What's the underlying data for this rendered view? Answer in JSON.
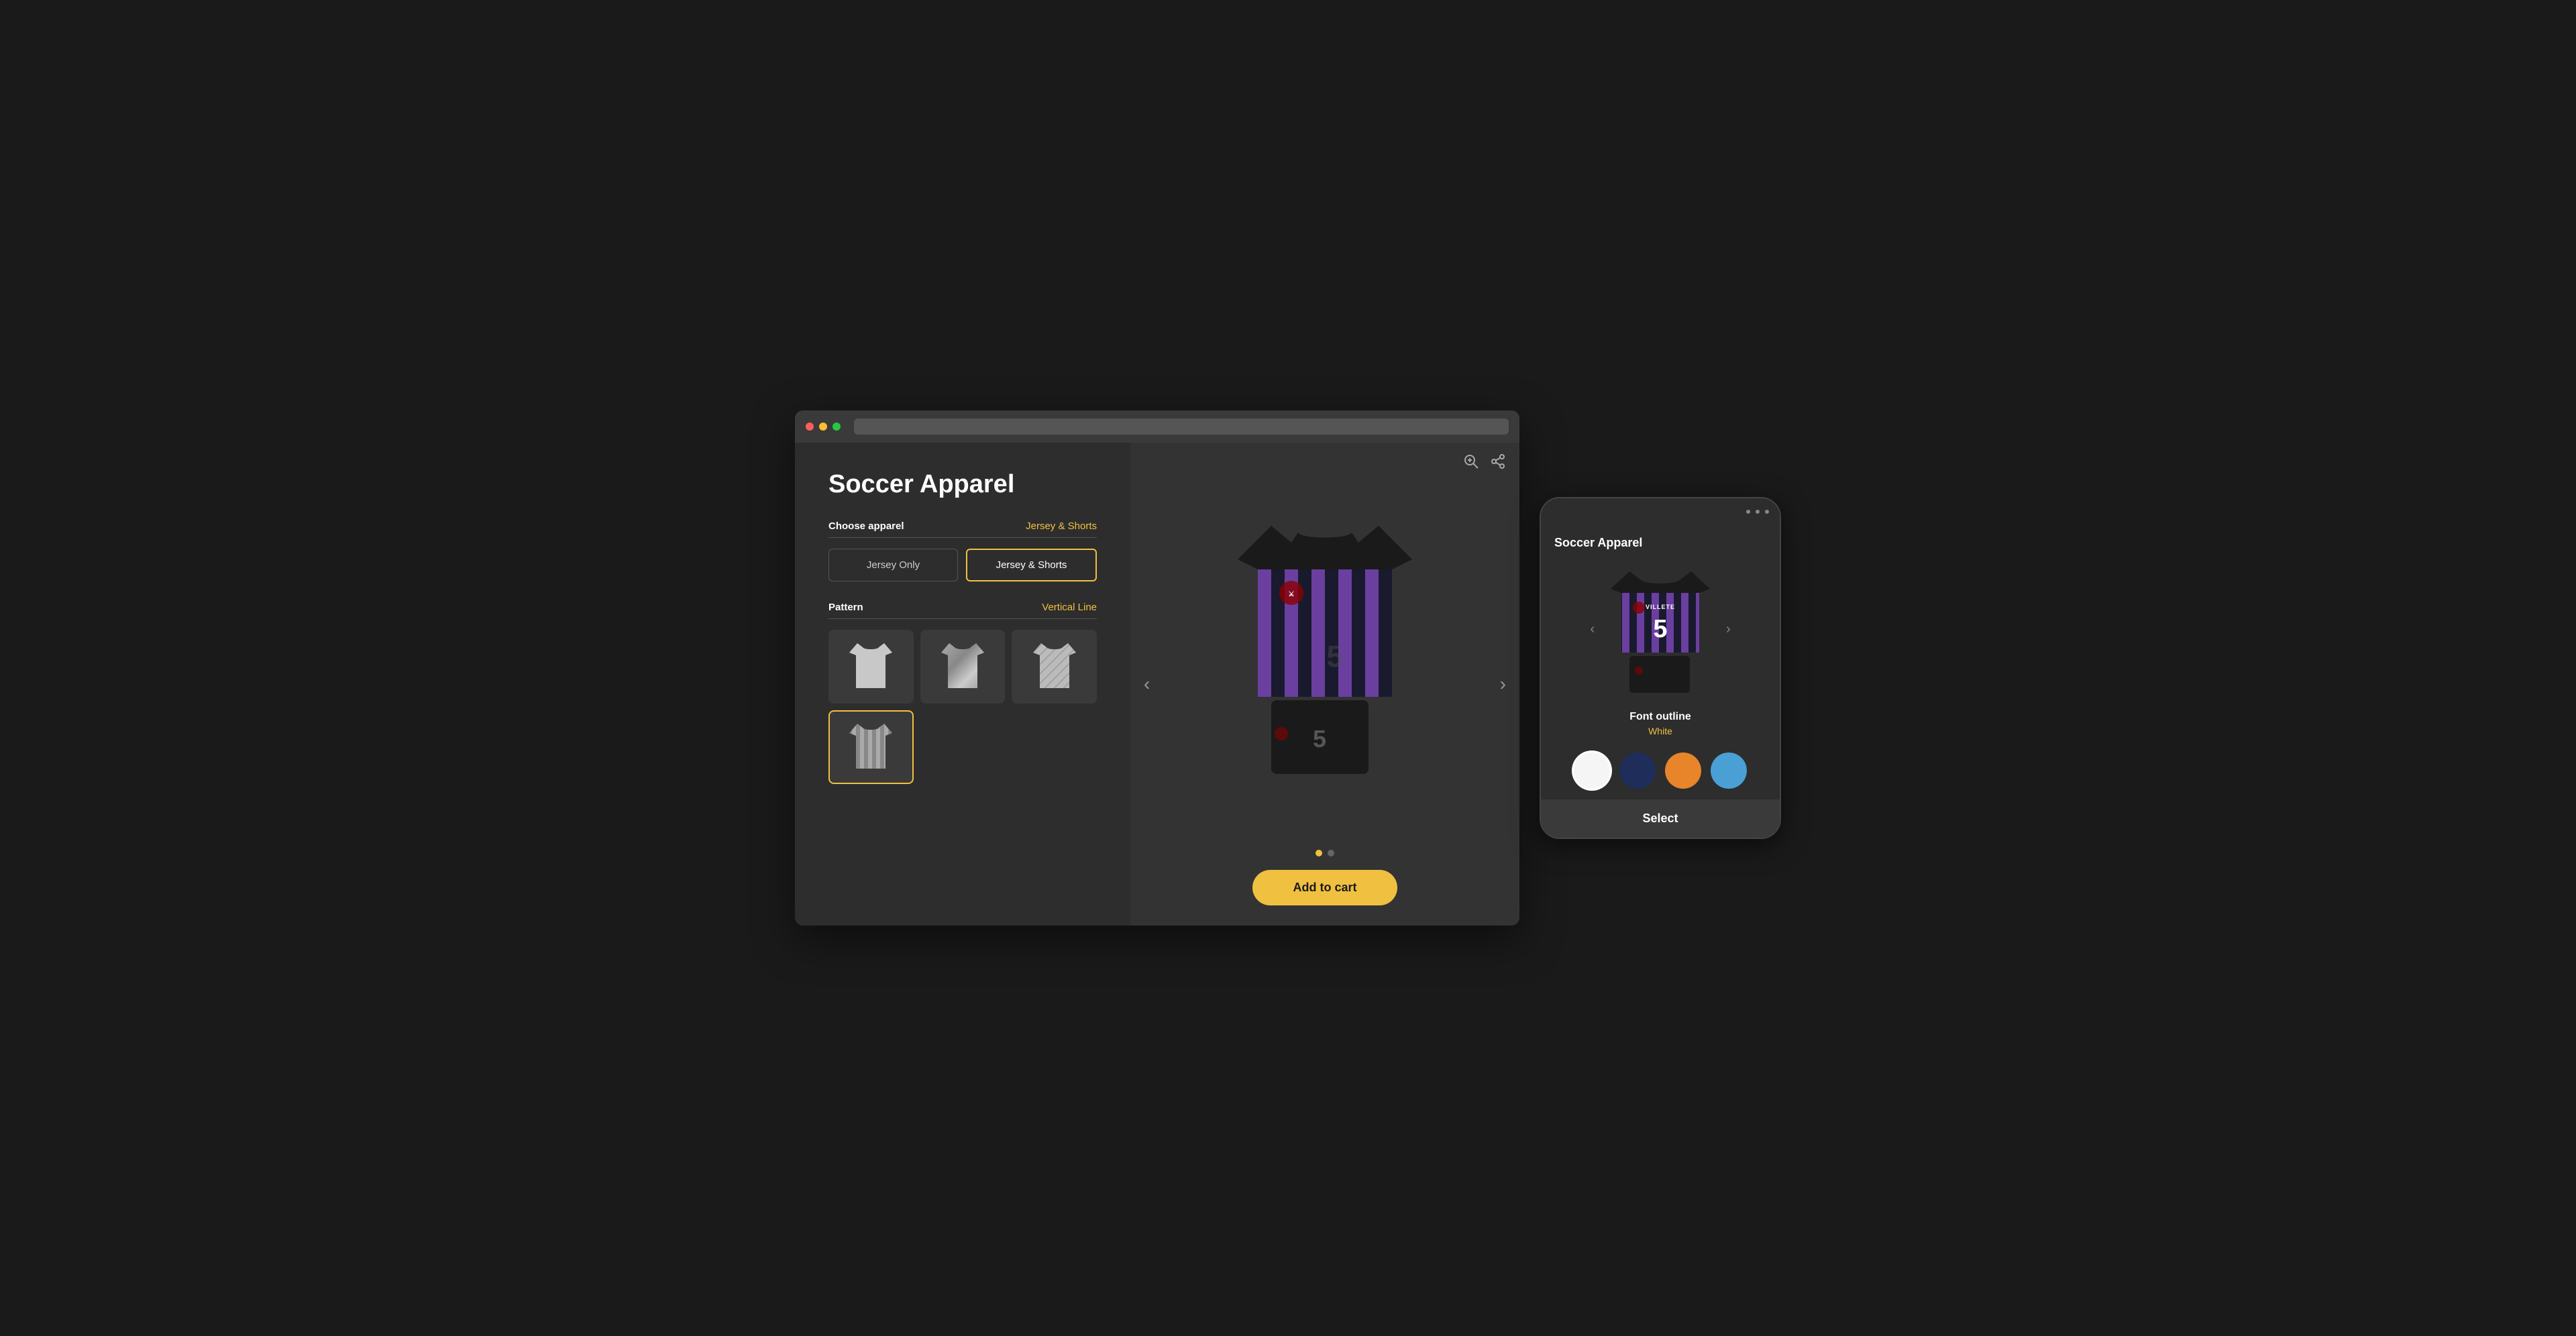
{
  "browser": {
    "dots": [
      "red",
      "yellow",
      "green"
    ]
  },
  "left_panel": {
    "title": "Soccer Apparel",
    "choose_apparel_label": "Choose apparel",
    "choose_apparel_value": "Jersey & Shorts",
    "apparel_options": [
      {
        "id": "jersey-only",
        "label": "Jersey Only",
        "active": false
      },
      {
        "id": "jersey-shorts",
        "label": "Jersey & Shorts",
        "active": true
      }
    ],
    "pattern_label": "Pattern",
    "pattern_value": "Vertical Line",
    "patterns": [
      {
        "id": "plain",
        "selected": false
      },
      {
        "id": "diagonal-stripe",
        "selected": false
      },
      {
        "id": "diagonal-lines",
        "selected": false
      },
      {
        "id": "vertical-stripe",
        "selected": true
      },
      {
        "id": "more",
        "selected": false
      },
      {
        "id": "extra",
        "selected": false
      }
    ]
  },
  "center_panel": {
    "carousel_dots": [
      {
        "active": true
      },
      {
        "active": false
      }
    ],
    "add_to_cart_label": "Add to cart",
    "icons": {
      "zoom": "⊕",
      "share": "⟨⟩"
    }
  },
  "mobile": {
    "title": "Soccer Apparel",
    "font_outline_label": "Font outline",
    "font_outline_value": "White",
    "colors": [
      {
        "hex": "#f5f5f5",
        "selected": true,
        "name": "white"
      },
      {
        "hex": "#1e2d5a",
        "selected": false,
        "name": "navy"
      },
      {
        "hex": "#e8842a",
        "selected": false,
        "name": "orange"
      },
      {
        "hex": "#4a9fd4",
        "selected": false,
        "name": "blue"
      }
    ],
    "select_label": "Select"
  }
}
